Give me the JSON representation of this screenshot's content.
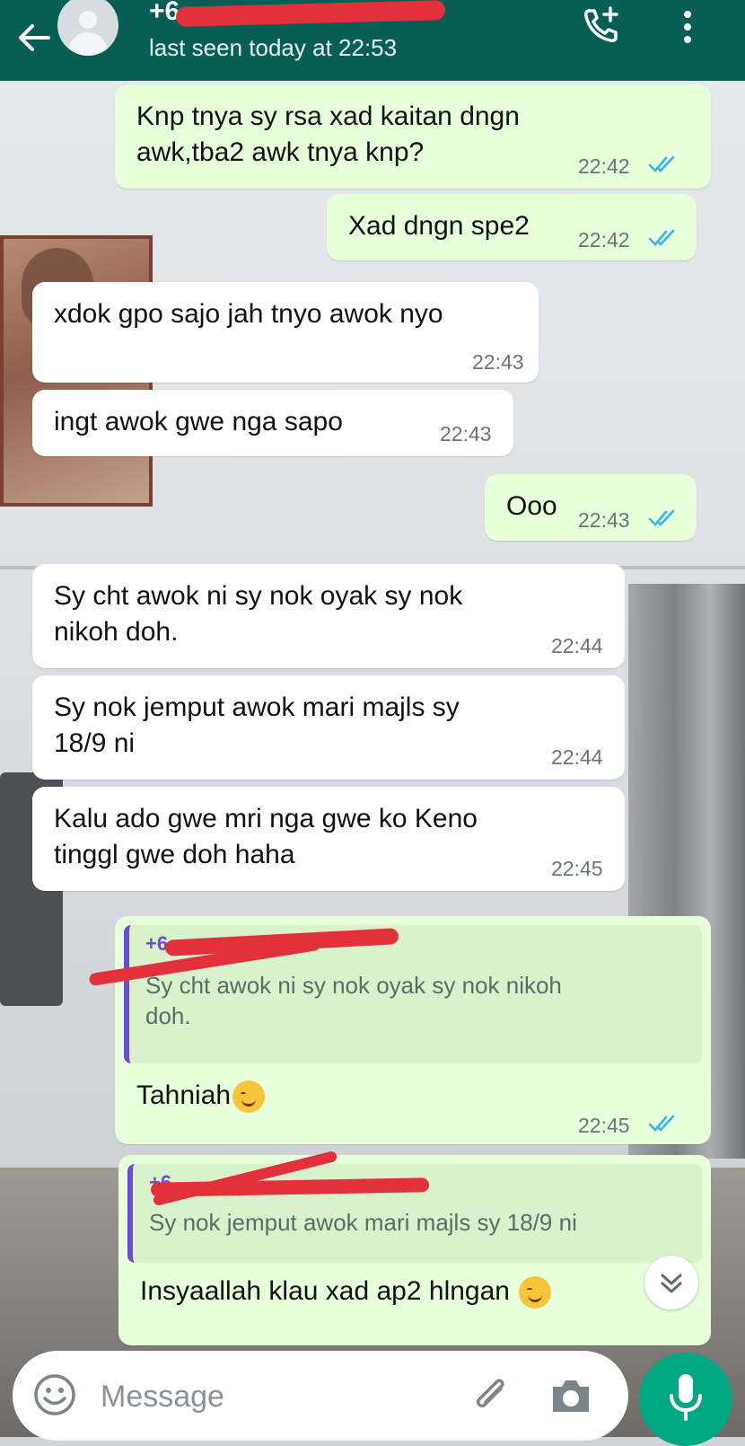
{
  "header": {
    "contact_name": "+6",
    "status": "last seen today at 22:53"
  },
  "messages": [
    {
      "dir": "out",
      "text_lines": [
        "Knp tnya sy rsa xad kaitan dngn",
        "awk,tba2 awk tnya knp?"
      ],
      "time": "22:42"
    },
    {
      "dir": "out",
      "text_lines": [
        "Xad dngn spe2"
      ],
      "time": "22:42"
    },
    {
      "dir": "in",
      "text_lines": [
        "xdok gpo sajo jah tnyo awok nyo"
      ],
      "time": "22:43"
    },
    {
      "dir": "in",
      "text_lines": [
        "ingt awok gwe nga sapo"
      ],
      "time": "22:43"
    },
    {
      "dir": "out",
      "text_lines": [
        "Ooo"
      ],
      "time": "22:43"
    },
    {
      "dir": "in",
      "text_lines": [
        "Sy cht awok ni sy nok oyak sy nok",
        "nikoh doh."
      ],
      "time": "22:44"
    },
    {
      "dir": "in",
      "text_lines": [
        "Sy nok jemput awok mari majls sy",
        "18/9 ni"
      ],
      "time": "22:44"
    },
    {
      "dir": "in",
      "text_lines": [
        "Kalu ado gwe mri nga gwe ko Keno",
        "tinggl gwe doh haha"
      ],
      "time": "22:45"
    }
  ],
  "replies": [
    {
      "quote_name": "+6",
      "quote_text_lines": [
        "Sy cht awok ni sy nok oyak sy nok nikoh",
        "doh."
      ],
      "text": "Tahniah",
      "emoji": "smiling-face-emoji",
      "time": "22:45"
    },
    {
      "quote_name": "+6",
      "quote_text_lines": [
        "Sy nok jemput awok mari majls sy 18/9 ni"
      ],
      "text": "Insyaallah klau xad ap2 hlngan",
      "emoji": "smiling-face-emoji"
    }
  ],
  "input": {
    "placeholder": "Message"
  },
  "colors": {
    "header": "#075e54",
    "outgoing_bubble": "#e7ffdb",
    "incoming_bubble": "#ffffff",
    "read_tick": "#34b7f1",
    "mic_button": "#00a884",
    "quote_accent": "#6c4bd6"
  },
  "icons": [
    "back-arrow-icon",
    "avatar-placeholder",
    "add-call-icon",
    "more-vert-icon",
    "double-check-icon",
    "scroll-down-icon",
    "emoji-icon",
    "attach-icon",
    "camera-icon",
    "mic-icon"
  ]
}
